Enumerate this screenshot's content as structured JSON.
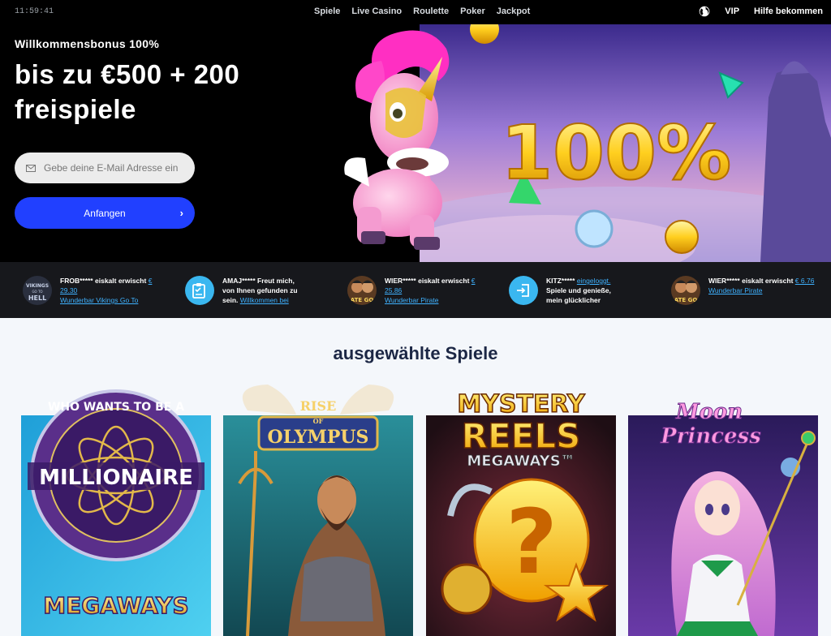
{
  "topbar": {
    "time": "11:59:41",
    "nav": [
      "Spiele",
      "Live Casino",
      "Roulette",
      "Poker",
      "Jackpot"
    ],
    "vip": "VIP",
    "help": "Hilfe bekommen"
  },
  "hero": {
    "bonus_small": "Willkommensbonus 100%",
    "bonus_line1": "bis zu €500 + 200",
    "bonus_line2": "freispiele",
    "email_placeholder": "Gebe deine E-Mail Adresse ein",
    "cta_label": "Anfangen",
    "art_text": "100%"
  },
  "ticker": [
    {
      "user": "FROB*****",
      "action": "eiskalt erwischt",
      "amount": "€ 29.30",
      "link": "Wunderbar Vikings Go To",
      "thumb_text": "VIKINGS GO TO HELL"
    },
    {
      "user": "AMAJ*****",
      "action": "Freut mich, von Ihnen gefunden zu sein.",
      "amount": "",
      "link": "Willkommen bei",
      "thumb_text": ""
    },
    {
      "user": "WIER*****",
      "action": "eiskalt erwischt",
      "amount": "€ 25.86",
      "link": "Wunderbar Pirate",
      "thumb_text": "ATE GO"
    },
    {
      "user": "KITZ*****",
      "action": "",
      "amount": "eingeloggt.",
      "link": "Spiele und genieße, mein glücklicher",
      "thumb_text": ""
    },
    {
      "user": "WIER*****",
      "action": "eiskalt erwischt",
      "amount": "€ 6.76",
      "link": "Wunderbar Pirate",
      "thumb_text": "ATE GO"
    }
  ],
  "featured": {
    "title": "ausgewählte Spiele",
    "games": [
      {
        "name": "Millionaire Megaways",
        "t1": "WHO WANTS TO BE A",
        "t2": "MILLIONAIRE",
        "t3": "MEGAWAYS"
      },
      {
        "name": "Rise of Olympus",
        "t1": "RISE",
        "t2": "OF",
        "t3": "OLYMPUS"
      },
      {
        "name": "Mystery Reels Megaways",
        "t1": "MYSTERY",
        "t2": "REELS",
        "t3": "MEGAWAYS™"
      },
      {
        "name": "Moon Princess",
        "t1": "Moon",
        "t2": "Princess",
        "t3": ""
      }
    ]
  },
  "colors": {
    "accent": "#2140ff",
    "link": "#3fb2ff",
    "ticker_bg": "#17181c"
  }
}
